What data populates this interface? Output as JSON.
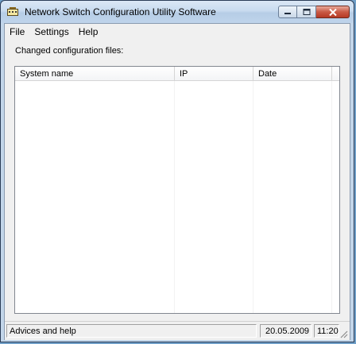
{
  "window": {
    "title": "Network Switch Configuration Utility Software",
    "icon": "network-switch-icon"
  },
  "menu": {
    "items": [
      {
        "label": "File"
      },
      {
        "label": "Settings"
      },
      {
        "label": "Help"
      }
    ]
  },
  "main": {
    "label": "Changed configuration files:",
    "list": {
      "columns": [
        "System name",
        "IP",
        "Date"
      ],
      "rows": []
    }
  },
  "status": {
    "help_text": "Advices and help",
    "date": "20.05.2009",
    "time": "11:20"
  },
  "colors": {
    "close_button": "#c95a45",
    "title_bar": "#c8dbef"
  }
}
